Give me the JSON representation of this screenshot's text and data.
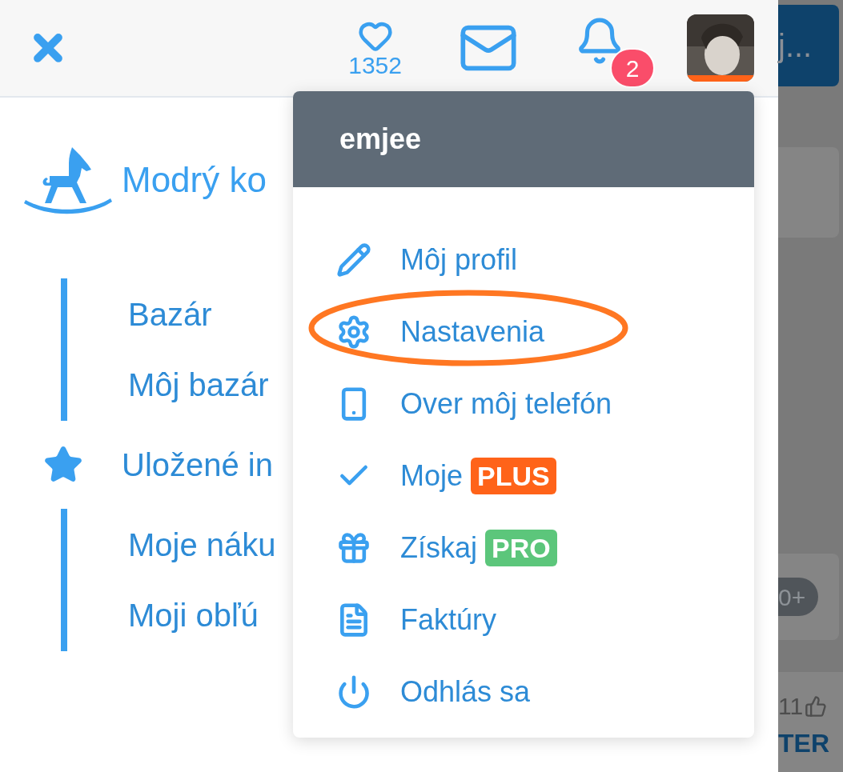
{
  "header": {
    "likes": "1352",
    "notifications": "2"
  },
  "logo": {
    "text": "Modrý ko"
  },
  "sidebar": {
    "sections": [
      {
        "kind": "bar",
        "items": [
          {
            "label": "Bazár"
          },
          {
            "label": "Môj bazár"
          }
        ]
      },
      {
        "kind": "star",
        "label": "Uložené in"
      },
      {
        "kind": "bar",
        "items": [
          {
            "label": "Moje náku"
          },
          {
            "label": "Moji obľú"
          }
        ]
      }
    ]
  },
  "menu": {
    "username": "emjee",
    "items": [
      {
        "label": "Môj profil",
        "highlighted": false
      },
      {
        "label": "Nastavenia",
        "highlighted": true
      },
      {
        "label": "Over môj telefón",
        "highlighted": false
      },
      {
        "label": "Moje",
        "badge": {
          "text": "PLUS",
          "color": "#ff6319"
        },
        "highlighted": false
      },
      {
        "label": "Získaj",
        "badge": {
          "text": "PRO",
          "color": "#5cc67b"
        },
        "highlighted": false
      },
      {
        "label": "Faktúry",
        "highlighted": false
      },
      {
        "label": "Odhlás sa",
        "highlighted": false
      }
    ]
  },
  "background": {
    "button": "j...",
    "pill": "0+",
    "likes": "11",
    "heading": "TER"
  }
}
